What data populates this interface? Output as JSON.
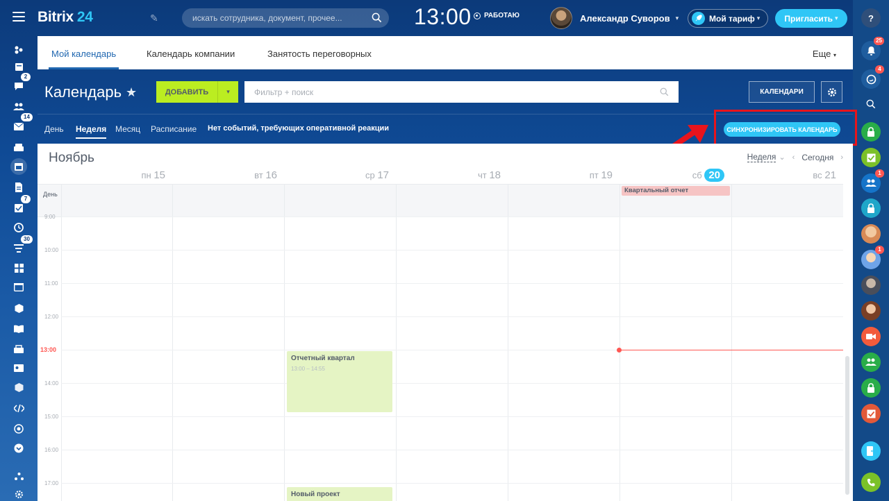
{
  "header": {
    "logo_text": "Bitrix",
    "logo_num": "24",
    "search_placeholder": "искать сотрудника, документ, прочее...",
    "clock": "13:00",
    "work_status": "РАБОТАЮ",
    "user_name": "Александр Суворов",
    "tariff_label": "Мой тариф",
    "invite_label": "Пригласить"
  },
  "tabs": [
    "Мой календарь",
    "Календарь компании",
    "Занятость переговорных"
  ],
  "more_label": "Еще",
  "toolbar": {
    "title": "Календарь",
    "add_label": "ДОБАВИТЬ",
    "filter_placeholder": "Фильтр + поиск",
    "calendars_label": "КАЛЕНДАРИ"
  },
  "view_tabs": [
    "День",
    "Неделя",
    "Месяц",
    "Расписание"
  ],
  "counter_text": "Нет событий, требующих оперативной реакции",
  "sync_label": "СИНХРОНИЗИРОВАТЬ КАЛЕНДАРЬ",
  "calendar": {
    "month": "Ноябрь",
    "view": "Неделя",
    "today_label": "Сегодня",
    "days": [
      {
        "wd": "пн",
        "num": "15"
      },
      {
        "wd": "вт",
        "num": "16"
      },
      {
        "wd": "ср",
        "num": "17"
      },
      {
        "wd": "чт",
        "num": "18"
      },
      {
        "wd": "пт",
        "num": "19"
      },
      {
        "wd": "сб",
        "num": "20"
      },
      {
        "wd": "вс",
        "num": "21"
      }
    ],
    "allday_label": "День",
    "hours": [
      "9:00",
      "10:00",
      "11:00",
      "12:00",
      "13:00",
      "14:00",
      "15:00",
      "16:00",
      "17:00"
    ],
    "events": [
      {
        "name": "Квартальный отчет",
        "day": "сб",
        "allday": true
      },
      {
        "name": "Отчетный квартал",
        "time": "13:00 – 14:55",
        "day": "ср"
      },
      {
        "name": "Новый проект",
        "day": "ср"
      }
    ]
  },
  "left_badges": [
    "2",
    "14",
    "7",
    "30"
  ],
  "right_badges": [
    "25",
    "4",
    "1",
    "1"
  ],
  "colors": {
    "accent": "#2fc6f6",
    "add_button": "#bbed21",
    "now_line": "#ff5752",
    "highlight": "#e8141c"
  }
}
